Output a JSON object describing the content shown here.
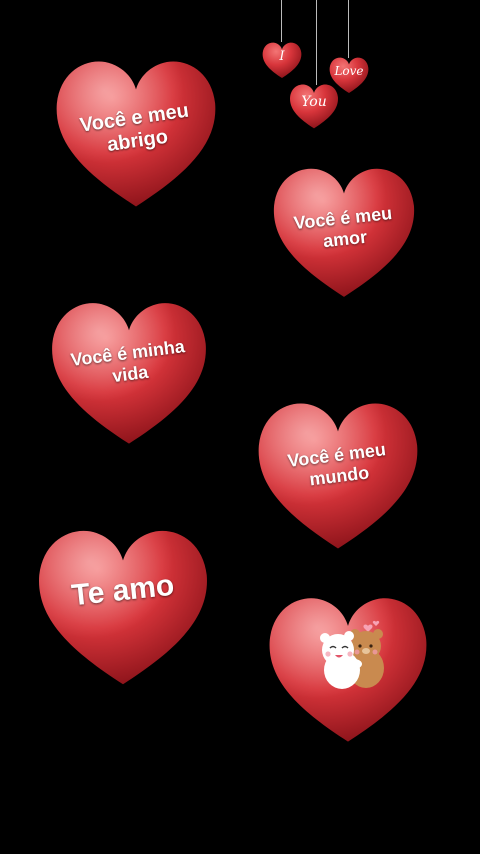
{
  "colors": {
    "background": "#000000",
    "heart_main": "#d9343a",
    "heart_dark": "#8a1018",
    "heart_light": "#f26a6a"
  },
  "hanging": {
    "i": "I",
    "love": "Love",
    "you": "You"
  },
  "hearts": {
    "h1": "Você e meu abrigo",
    "h2": "Você é meu amor",
    "h3": "Você é minha vida",
    "h4": "Você é meu mundo",
    "h5": "Te amo"
  },
  "sticker": {
    "icon": "hugging-bears-sticker"
  }
}
